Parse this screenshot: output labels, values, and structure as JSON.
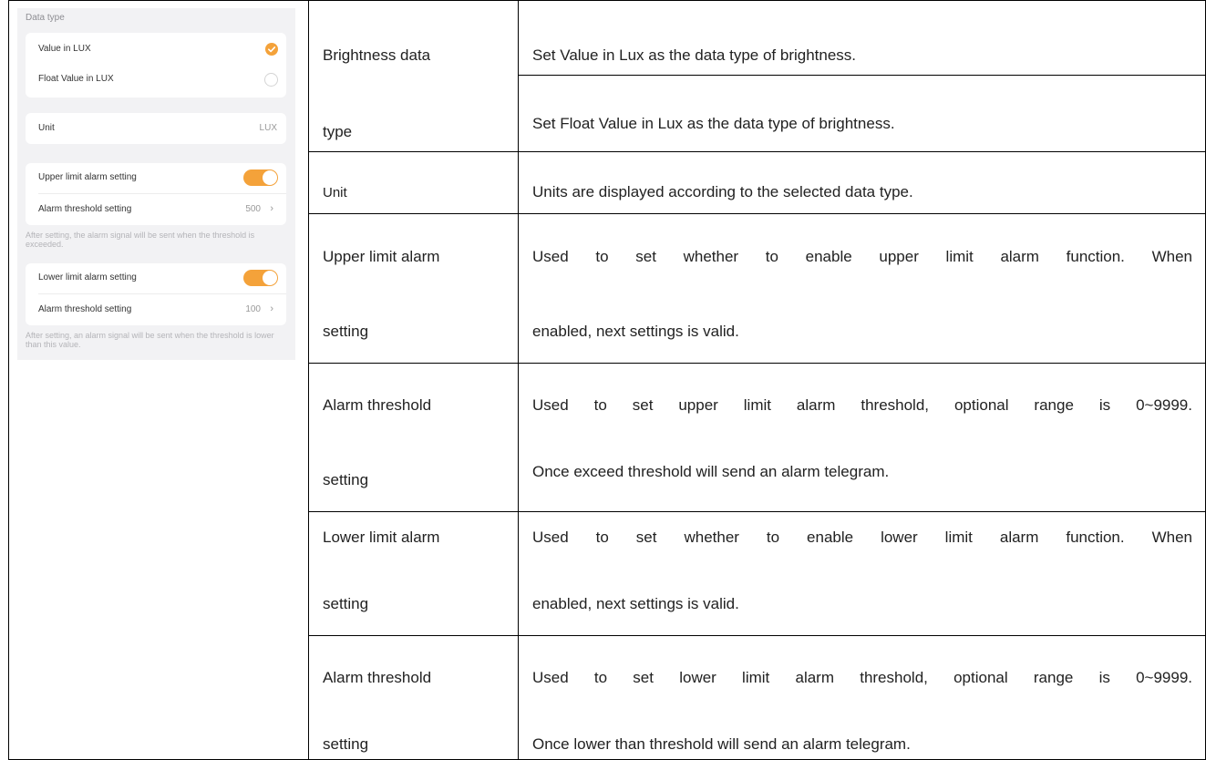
{
  "panel": {
    "data_type_label": "Data type",
    "options": [
      {
        "label": "Value in LUX",
        "selected": true
      },
      {
        "label": "Float Value in LUX",
        "selected": false
      }
    ],
    "unit": {
      "label": "Unit",
      "value": "LUX"
    },
    "upper": {
      "toggle_label": "Upper limit alarm setting",
      "enabled": true,
      "threshold_label": "Alarm threshold setting",
      "threshold_value": "500",
      "hint": "After setting, the alarm signal will be sent when the threshold is exceeded."
    },
    "lower": {
      "toggle_label": "Lower limit alarm setting",
      "enabled": true,
      "threshold_label": "Alarm threshold setting",
      "threshold_value": "100",
      "hint": "After setting, an alarm signal will be sent when the threshold is lower than this value."
    },
    "accent_color": "#f4a23a",
    "chevron_icon": "chevron-right-icon",
    "check_icon": "checkmark-icon"
  },
  "table": {
    "brightness": {
      "name_line1": "Brightness data",
      "name_line2": "type",
      "desc1": "Set Value in Lux as the data type of brightness.",
      "desc2": "Set Float Value in Lux as the data type of brightness."
    },
    "unit": {
      "name": "Unit",
      "desc": "Units are displayed according to the selected data type."
    },
    "upper_limit": {
      "name_line1": "Upper limit alarm",
      "name_line2": "setting",
      "desc_line1": "Used to set whether to enable upper limit alarm function. When",
      "desc_line2": "enabled, next settings is valid."
    },
    "upper_threshold": {
      "name_line1": "Alarm threshold",
      "name_line2": "setting",
      "desc_line1": "Used to set upper limit alarm threshold, optional range is 0~9999.",
      "desc_line2": "Once exceed threshold will send an alarm telegram."
    },
    "lower_limit": {
      "name_line1": "Lower limit alarm",
      "name_line2": "setting",
      "desc_line1": "Used to set whether to enable lower limit alarm function. When",
      "desc_line2": "enabled, next settings is valid."
    },
    "lower_threshold": {
      "name_line1": "Alarm threshold",
      "name_line2": "setting",
      "desc_line1": "Used to set lower limit alarm threshold, optional range is 0~9999.",
      "desc_line2": "Once lower than threshold will send an alarm telegram."
    }
  }
}
